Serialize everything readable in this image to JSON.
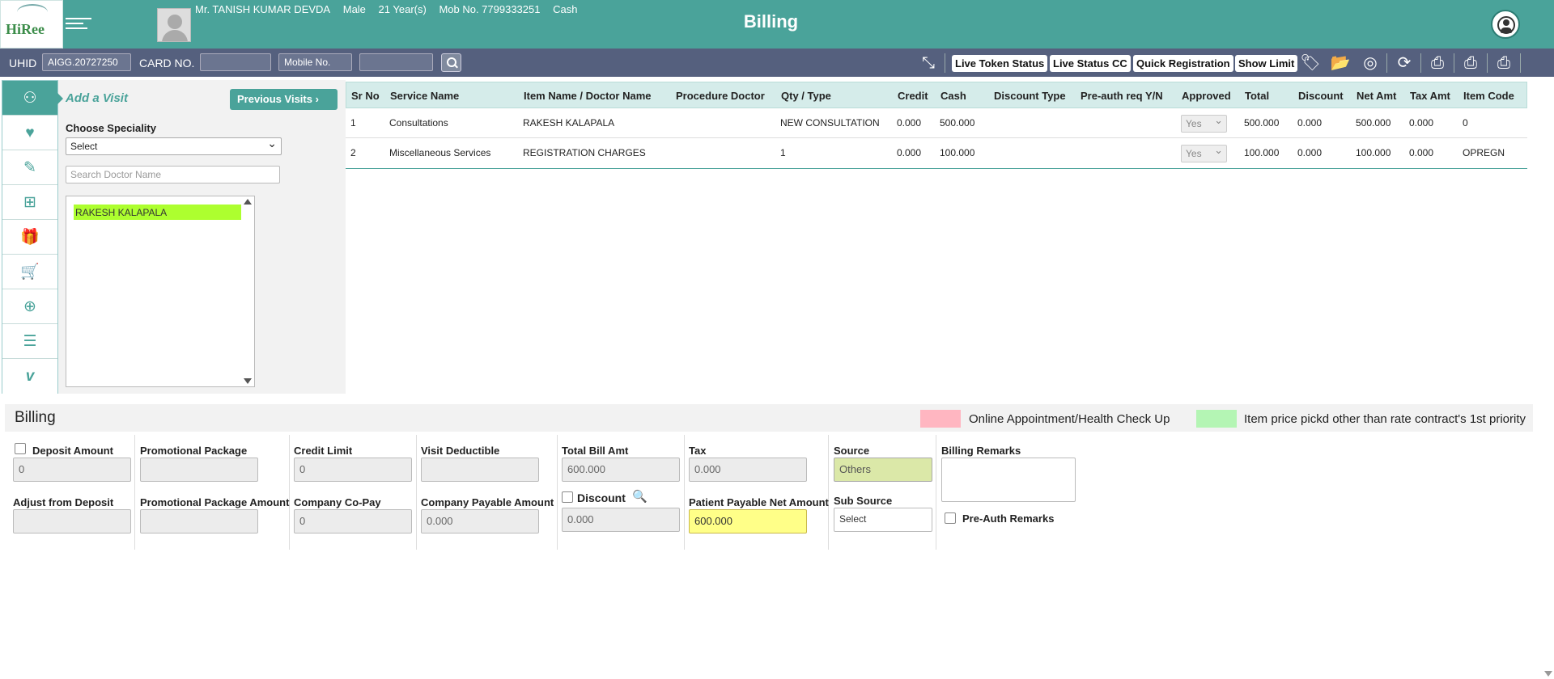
{
  "header": {
    "logo": "HiRee",
    "title": "Billing",
    "patient": {
      "name": "Mr. TANISH KUMAR DEVDA",
      "gender": "Male",
      "age": "21 Year(s)",
      "mobile": "Mob No. 7799333251",
      "payment": "Cash"
    }
  },
  "toolbar": {
    "uhid_label": "UHID",
    "uhid_value": "AIGG.20727250",
    "card_label": "CARD NO.",
    "mobile_placeholder": "Mobile No.",
    "buttons": [
      "Live Token Status",
      "Live Status CC",
      "Quick Registration",
      "Show Limit"
    ]
  },
  "visit": {
    "add_visit": "Add a Visit",
    "previous_visits": "Previous Visits",
    "choose_speciality": "Choose Speciality",
    "speciality_value": "Select",
    "search_placeholder": "Search Doctor Name",
    "doctors": [
      "RAKESH KALAPALA"
    ]
  },
  "grid": {
    "headers": [
      "Sr No",
      "Service Name",
      "Item Name / Doctor Name",
      "Procedure Doctor",
      "Qty / Type",
      "Credit",
      "Cash",
      "Discount Type",
      "Pre-auth req Y/N",
      "Approved",
      "Total",
      "Discount",
      "Net Amt",
      "Tax Amt",
      "Item Code"
    ],
    "rows": [
      {
        "sr": "1",
        "service": "Consultations",
        "item": "RAKESH KALAPALA",
        "proc": "",
        "qty": "NEW CONSULTATION",
        "credit": "0.000",
        "cash": "500.000",
        "disc_type": "",
        "preauth": "",
        "approved": "Yes",
        "total": "500.000",
        "discount": "0.000",
        "net": "500.000",
        "tax": "0.000",
        "code": "0"
      },
      {
        "sr": "2",
        "service": "Miscellaneous Services",
        "item": "REGISTRATION CHARGES",
        "proc": "",
        "qty": "1",
        "credit": "0.000",
        "cash": "100.000",
        "disc_type": "",
        "preauth": "",
        "approved": "Yes",
        "total": "100.000",
        "discount": "0.000",
        "net": "100.000",
        "tax": "0.000",
        "code": "OPREGN"
      }
    ]
  },
  "billing": {
    "title": "Billing",
    "legend": [
      {
        "label": "Online Appointment/Health Check Up",
        "color": "#ffb6c1"
      },
      {
        "label": "Item price pickd other than rate contract's 1st priority",
        "color": "#b4f5b4"
      }
    ],
    "deposit_amount_label": "Deposit Amount",
    "deposit_amount": "0",
    "adjust_deposit_label": "Adjust from Deposit",
    "adjust_deposit": "",
    "promo_package_label": "Promotional Package",
    "promo_package": "",
    "promo_amount_label": "Promotional Package Amount",
    "promo_amount": "",
    "credit_limit_label": "Credit Limit",
    "credit_limit": "0",
    "copay_label": "Company Co-Pay",
    "copay": "0",
    "visit_deductible_label": "Visit Deductible",
    "visit_deductible": "",
    "company_payable_label": "Company Payable Amount",
    "company_payable": "0.000",
    "total_bill_label": "Total Bill Amt",
    "total_bill": "600.000",
    "discount_label": "Discount",
    "discount": "0.000",
    "tax_label": "Tax",
    "tax": "0.000",
    "patient_payable_label": "Patient Payable Net Amount",
    "patient_payable": "600.000",
    "source_label": "Source",
    "source": "Others",
    "sub_source_label": "Sub Source",
    "sub_source": "Select",
    "remarks_label": "Billing Remarks",
    "remarks": "",
    "preauth_label": "Pre-Auth Remarks"
  }
}
